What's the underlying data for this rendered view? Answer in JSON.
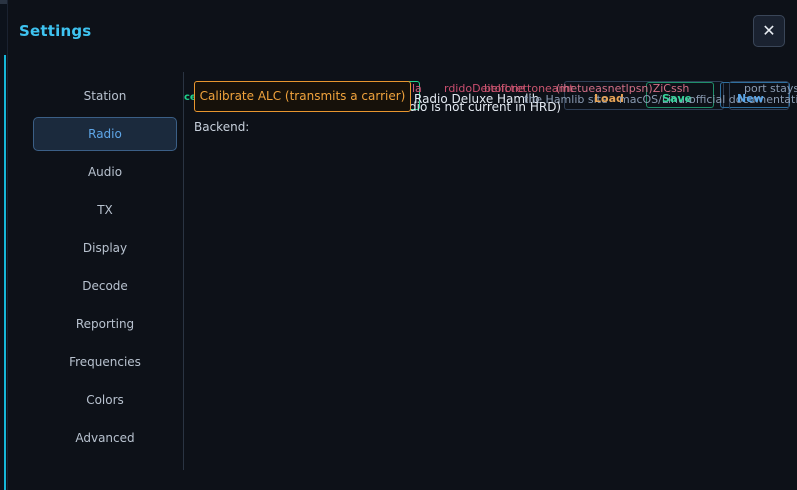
{
  "title": "Settings",
  "close_label": "✕",
  "nav": [
    {
      "label": "Station"
    },
    {
      "label": "Radio"
    },
    {
      "label": "Audio"
    },
    {
      "label": "TX"
    },
    {
      "label": "Display"
    },
    {
      "label": "Decode"
    },
    {
      "label": "Reporting"
    },
    {
      "label": "Frequencies"
    },
    {
      "label": "Colors"
    },
    {
      "label": "Advanced"
    }
  ],
  "active_nav": "Radio",
  "panel": {
    "calibrate_label": "Calibrate ALC (transmits a carrier)",
    "backend_label": "Backend:",
    "overlap": {
      "teal_frag": "ce",
      "red_frag1": "la",
      "red_frag2": "rdidoDeitoictie",
      "red_frag3": "belfbrettoneamt",
      "red_frag4": "(ihetueasnetlpsn)ZiCssh",
      "radio_frag": "Radio Deluxe Hamlib",
      "hamlib_frag": "the Hamlib site",
      "white_frag2": "dio is not current in HRD)",
      "load_frag": "Load",
      "macos_frag": "macOS/Linux",
      "save_frag": "Save",
      "official_frag": "official documentation",
      "new_frag": "New",
      "port_frag": "port stays w"
    }
  }
}
